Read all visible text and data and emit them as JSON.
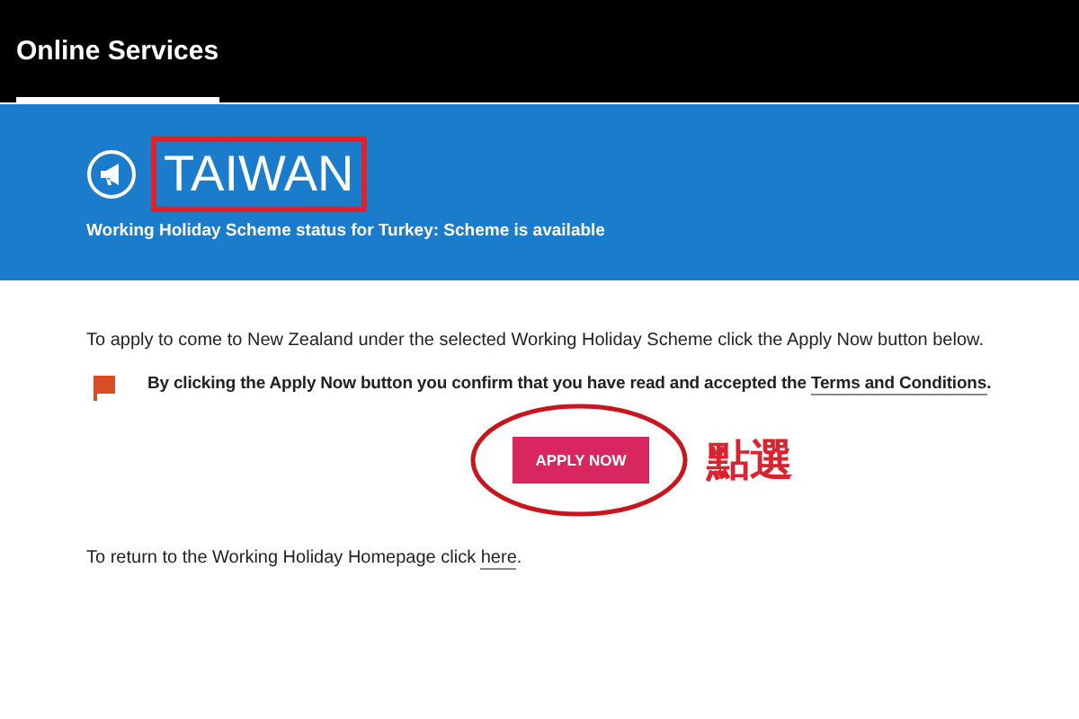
{
  "header": {
    "tabs": [
      {
        "label": "Online Services",
        "selected": true
      }
    ]
  },
  "banner": {
    "title": "TAIWAN",
    "status": "Working Holiday Scheme status for Turkey: **Scheme is available**"
  },
  "intro": "To apply to come to New Zealand under the selected Working Holiday Scheme click the Apply Now button below.",
  "notice": {
    "before": "By clicking the Apply Now button you confirm that you have read and accepted the ",
    "link": "Terms and Conditions",
    "after": "."
  },
  "apply_button": "APPLY NOW",
  "annotation": {
    "label": "點選"
  },
  "return": {
    "before": "To return to the Working Holiday Homepage click ",
    "link": "here",
    "after": "."
  }
}
